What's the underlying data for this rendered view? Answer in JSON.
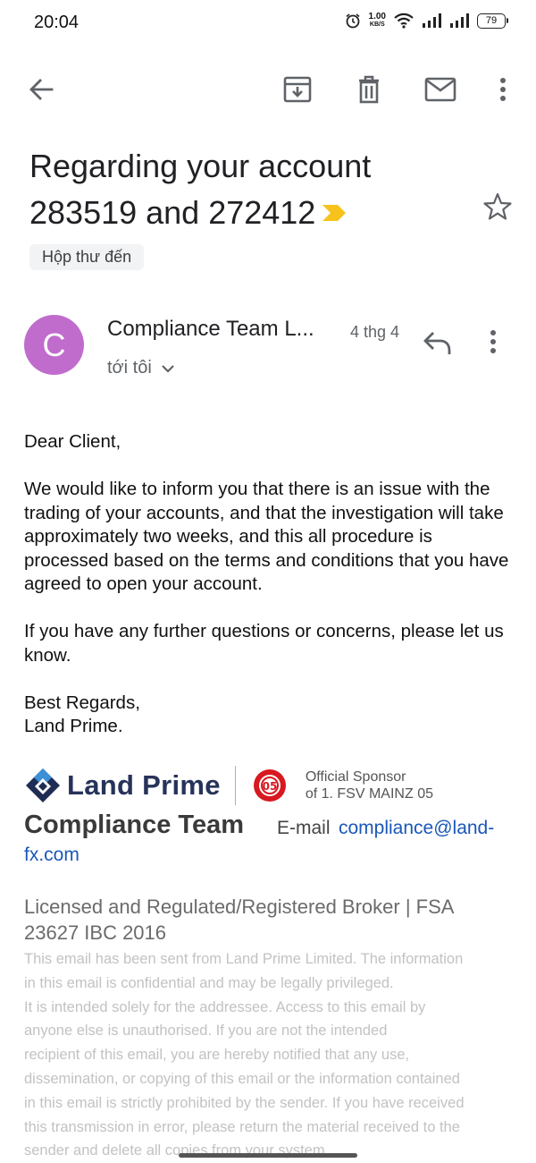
{
  "status_bar": {
    "time": "20:04",
    "net_speed_value": "1.00",
    "net_speed_unit": "KB/S",
    "battery": "79",
    "icons": [
      "alarm-icon",
      "wifi-icon",
      "signal-icon",
      "signal-icon",
      "battery-icon"
    ]
  },
  "toolbar": {
    "icons": [
      "back-arrow-icon",
      "archive-icon",
      "trash-icon",
      "mail-icon",
      "more-vert-icon"
    ]
  },
  "email": {
    "subject_line1": "Regarding your account",
    "subject_line2": "283519 and 272412",
    "importance_color": "#f7c21b",
    "label": "Hộp thư đến",
    "sender": {
      "initial": "C",
      "avatar_color": "#c06ccd",
      "name": "Compliance Team L...",
      "date": "4 thg 4",
      "recipient": "tới tôi"
    },
    "body": {
      "greeting": "Dear Client,",
      "paragraph1": "We would like to inform you that there is an issue with the trading of your accounts, and that the investigation will take approximately two weeks, and this all procedure is processed based on the terms and conditions that you have agreed to open your account.",
      "paragraph2": "If you have any further questions or concerns, please let us know.",
      "closing": "Best Regards,",
      "closing_name": "Land Prime."
    },
    "signature": {
      "brand": "Land Prime",
      "sponsor_line1": "Official Sponsor",
      "sponsor_line2": "of 1. FSV MAINZ 05",
      "mainz_emblem_text": "05",
      "team": "Compliance Team",
      "email_label": "E-mail",
      "email_part1": "compliance@land-",
      "email_part2": "fx.com",
      "license": "Licensed and Regulated/Registered Broker | FSA 23627 IBC 2016",
      "disclaimer_lines": [
        "This email has been sent from Land Prime Limited. The information",
        "in this email is confidential and may be legally privileged.",
        "It is intended solely for the addressee. Access to this email by",
        "anyone else is unauthorised. If you are not the intended",
        "recipient of this email, you are hereby notified that any use,",
        "dissemination, or copying of this email or the information contained",
        "in this email is strictly prohibited by the sender. If you have received",
        "this transmission in error, please return the material received to the",
        "sender and delete all copies from your system."
      ]
    }
  }
}
